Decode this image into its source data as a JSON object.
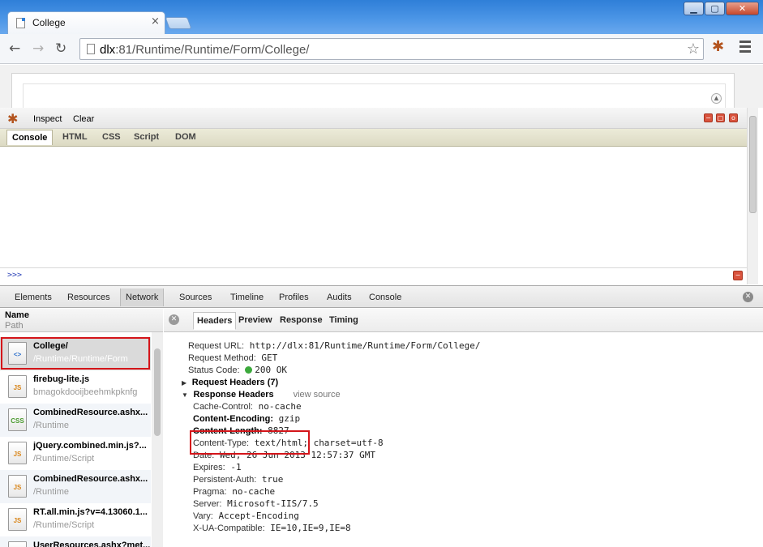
{
  "browser": {
    "tab_title": "College",
    "tab_close": "×",
    "url_host": "dlx",
    "url_rest": ":81/Runtime/Runtime/Form/College/",
    "window_buttons": [
      "▁",
      "▢",
      "✕"
    ],
    "back": "←",
    "forward": "→",
    "reload": "↻",
    "star": "☆",
    "page_collapse": "▲"
  },
  "firebug": {
    "inspect_label": "Inspect",
    "clear_label": "Clear",
    "tabs": [
      "Console",
      "HTML",
      "CSS",
      "Script",
      "DOM"
    ],
    "active_tab": "Console",
    "prompt": ">>>",
    "window_buttons": [
      "−",
      "▢",
      "o"
    ],
    "cmd_close": "−"
  },
  "devtools": {
    "tabs": [
      "Elements",
      "Resources",
      "Network",
      "Sources",
      "Timeline",
      "Profiles",
      "Audits",
      "Console"
    ],
    "active_tab": "Network",
    "close": "✕",
    "list_header": {
      "name": "Name",
      "path": "Path"
    },
    "requests": [
      {
        "name": "College/",
        "path": "/Runtime/Runtime/Form",
        "type": "doc",
        "icon_label": "<>"
      },
      {
        "name": "firebug-lite.js",
        "path": "bmagokdooijbeehmkpknfg",
        "type": "js",
        "icon_label": "JS"
      },
      {
        "name": "CombinedResource.ashx...",
        "path": "/Runtime",
        "type": "css",
        "icon_label": "CSS"
      },
      {
        "name": "jQuery.combined.min.js?...",
        "path": "/Runtime/Script",
        "type": "js",
        "icon_label": "JS"
      },
      {
        "name": "CombinedResource.ashx...",
        "path": "/Runtime",
        "type": "js",
        "icon_label": "JS"
      },
      {
        "name": "RT.all.min.js?v=4.13060.1...",
        "path": "/Runtime/Script",
        "type": "js",
        "icon_label": "JS"
      },
      {
        "name": "UserResources.ashx?met...",
        "path": "",
        "type": "js",
        "icon_label": "JS"
      }
    ],
    "detail": {
      "close": "✕",
      "tabs": [
        "Headers",
        "Preview",
        "Response",
        "Timing"
      ],
      "active_tab": "Headers",
      "general": [
        {
          "key": "Request URL:",
          "value": "http://dlx:81/Runtime/Runtime/Form/College/"
        },
        {
          "key": "Request Method:",
          "value": "GET"
        },
        {
          "key": "Status Code:",
          "value": "200 OK"
        }
      ],
      "request_headers_label": "Request Headers (7)",
      "response_headers_label": "Response Headers",
      "view_source": "view source",
      "response_headers": [
        {
          "key": "Cache-Control:",
          "value": "no-cache"
        },
        {
          "key": "Content-Encoding:",
          "value": "gzip"
        },
        {
          "key": "Content-Length:",
          "value": "8827"
        },
        {
          "key": "Content-Type:",
          "value": "text/html; charset=utf-8"
        },
        {
          "key": "Date:",
          "value": "Wed, 26 Jun 2013 12:57:37 GMT"
        },
        {
          "key": "Expires:",
          "value": "-1"
        },
        {
          "key": "Persistent-Auth:",
          "value": "true"
        },
        {
          "key": "Pragma:",
          "value": "no-cache"
        },
        {
          "key": "Server:",
          "value": "Microsoft-IIS/7.5"
        },
        {
          "key": "Vary:",
          "value": "Accept-Encoding"
        },
        {
          "key": "X-UA-Compatible:",
          "value": "IE=10,IE=9,IE=8"
        }
      ]
    }
  },
  "colors": {
    "titlebar": "#2f7fd8",
    "highlight": "#d4151a",
    "status_ok": "#3ca93c"
  }
}
